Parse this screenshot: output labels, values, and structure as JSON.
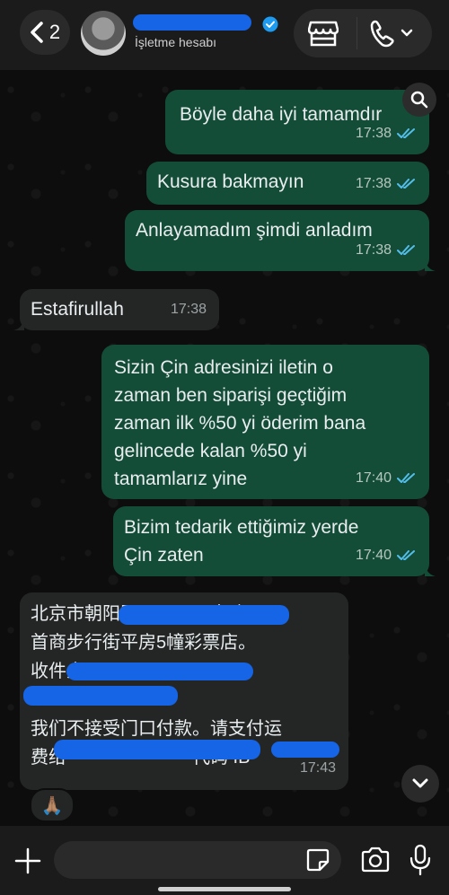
{
  "header": {
    "back_count": "2",
    "contact_name": "",
    "subtitle": "İşletme hesabı"
  },
  "messages": [
    {
      "direction": "out",
      "text": "Böyle daha iyi tamamdır",
      "time": "17:38",
      "status": "read"
    },
    {
      "direction": "out",
      "text": "Kusura bakmayın",
      "time": "17:38",
      "status": "read"
    },
    {
      "direction": "out",
      "text": "Anlayamadım şimdi anladım",
      "time": "17:38",
      "status": "read"
    },
    {
      "direction": "in",
      "text": "Estafirullah",
      "time": "17:38"
    },
    {
      "direction": "out",
      "lines": [
        "Sizin Çin adresinizi iletin o",
        "zaman ben siparişi geçtiğim",
        "zaman ilk %50 yi öderim bana",
        "gelincede kalan %50 yi",
        "tamamlarız yine"
      ],
      "time": "17:40",
      "status": "read"
    },
    {
      "direction": "out",
      "lines": [
        "Bizim tedarik ettiğimiz yerde",
        "Çin zaten"
      ],
      "time": "17:40",
      "status": "read"
    },
    {
      "direction": "in",
      "lines": [
        "北京市朝阳区　　　　南路3号",
        "首商步行街平房5幢彩票店。",
        "收件人：",
        "",
        "我们不接受门口付款。请支付运",
        "费给　　　　　　　代码 IB"
      ],
      "time": "17:43",
      "reaction": "🙏🏽"
    }
  ],
  "composer": {
    "placeholder": ""
  },
  "colors": {
    "outgoing_bubble": "#144d37",
    "incoming_bubble": "#242626",
    "read_ticks": "#53bdeb",
    "verified_badge": "#1d9bf0",
    "redaction": "#1565e6"
  },
  "icons": [
    "chevron-left-icon",
    "verified-badge-icon",
    "store-icon",
    "phone-icon",
    "chevron-down-icon",
    "search-icon",
    "plus-icon",
    "sticker-icon",
    "camera-icon",
    "microphone-icon",
    "double-check-icon"
  ]
}
